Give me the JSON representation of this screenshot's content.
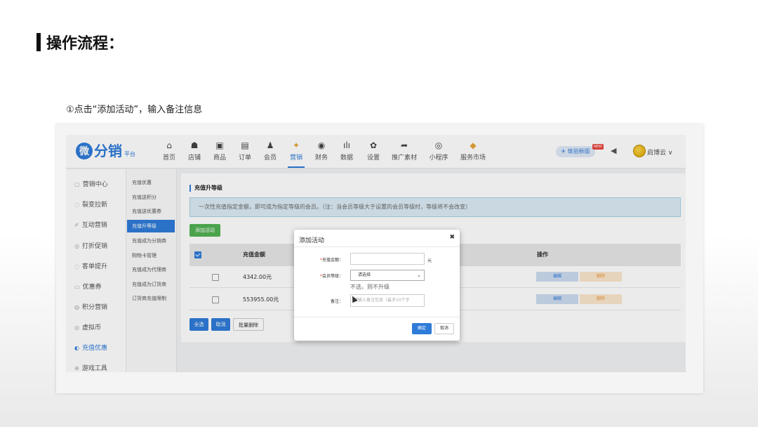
{
  "slide": {
    "title": "操作流程：",
    "step_note": "①点击“添加活动”，输入备注信息"
  },
  "topnav": {
    "logo_badge": "微",
    "logo_text": "分销",
    "logo_sub": "平台",
    "items": [
      {
        "label": "首页",
        "icon": "home-icon",
        "glyph": "⌂"
      },
      {
        "label": "店铺",
        "icon": "store-icon",
        "glyph": "☗"
      },
      {
        "label": "商品",
        "icon": "goods-icon",
        "glyph": "▣"
      },
      {
        "label": "订单",
        "icon": "order-icon",
        "glyph": "▤"
      },
      {
        "label": "会员",
        "icon": "member-icon",
        "glyph": "♟"
      },
      {
        "label": "营销",
        "icon": "marketing-icon",
        "glyph": "✦"
      },
      {
        "label": "财务",
        "icon": "finance-icon",
        "glyph": "◉"
      },
      {
        "label": "数据",
        "icon": "data-icon",
        "glyph": "ılı"
      },
      {
        "label": "设置",
        "icon": "settings-icon",
        "glyph": "✿"
      },
      {
        "label": "推广素材",
        "icon": "share-icon",
        "glyph": "➦"
      },
      {
        "label": "小程序",
        "icon": "miniapp-icon",
        "glyph": "◎"
      },
      {
        "label": "服务市场",
        "icon": "market-icon",
        "glyph": "◆"
      }
    ],
    "active_item": "营销",
    "tiyan_label": "体验新版",
    "new_tag": "NEW",
    "user_name": "启博云"
  },
  "sidebar1": [
    {
      "label": "营销中心",
      "icon": "grid-icon",
      "glyph": "▢"
    },
    {
      "label": "裂变拉新",
      "icon": "fission-icon",
      "glyph": "◌"
    },
    {
      "label": "互动营销",
      "icon": "interact-icon",
      "glyph": "✐"
    },
    {
      "label": "打折促销",
      "icon": "discount-icon",
      "glyph": "◎"
    },
    {
      "label": "客单提升",
      "icon": "upgrade-icon",
      "glyph": "◌"
    },
    {
      "label": "优惠券",
      "icon": "coupon-icon",
      "glyph": "▭"
    },
    {
      "label": "积分营销",
      "icon": "points-icon",
      "glyph": "◍"
    },
    {
      "label": "虚拟币",
      "icon": "coin-icon",
      "glyph": "◎"
    },
    {
      "label": "充值优惠",
      "icon": "recharge-icon",
      "glyph": "◐",
      "active": true
    },
    {
      "label": "游戏工具",
      "icon": "game-icon",
      "glyph": "⊕"
    }
  ],
  "sidebar2": [
    {
      "label": "充值优惠"
    },
    {
      "label": "充值送积分"
    },
    {
      "label": "充值送优惠券"
    },
    {
      "label": "充值升等级",
      "active": true
    },
    {
      "label": "充值成为分销商"
    },
    {
      "label": "购物卡管理"
    },
    {
      "label": "充值成为代理商"
    },
    {
      "label": "充值成为订货商"
    },
    {
      "label": "订货商充值限制"
    }
  ],
  "content": {
    "section_title": "充值升等级",
    "info_text": "一次性充值指定金额，即可成为指定等级的会员。（注：当会员等级大于设置的会员等级时，等级将不会改变）",
    "add_button": "添加活动",
    "columns": [
      "充值金额",
      "操作"
    ],
    "rows": [
      {
        "amount": "4342.00元",
        "edit": "编辑",
        "delete": "删除"
      },
      {
        "amount": "553955.00元",
        "edit": "编辑",
        "delete": "删除"
      }
    ],
    "select_all": "全选",
    "cancel": "取消",
    "batch_delete": "批量删除"
  },
  "modal": {
    "title": "添加活动",
    "amount_label": "充值金额：",
    "amount_value": "",
    "amount_unit": "元",
    "level_label": "会员等级：",
    "level_selected": "请选择",
    "level_hint": "不选，则不升级",
    "remark_label": "备注：",
    "remark_placeholder": "请输入备注信息（最多10个字",
    "ok": "确定",
    "cancel": "取消"
  },
  "colors": {
    "accent": "#2e7bd8",
    "add_button": "#52b153",
    "info_bg": "#dcecf5",
    "delete_bg": "#fbe6cc"
  }
}
